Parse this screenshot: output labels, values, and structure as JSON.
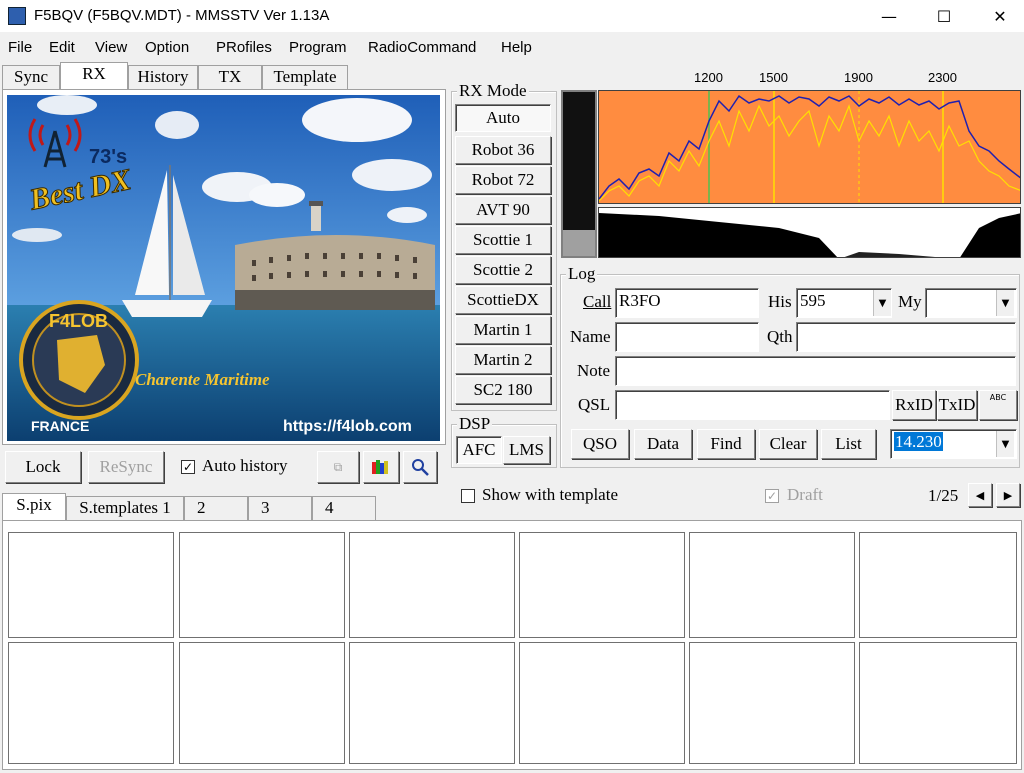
{
  "window": {
    "title": "F5BQV (F5BQV.MDT) - MMSSTV Ver 1.13A",
    "minimize": "—",
    "maximize": "☐",
    "close": "✕"
  },
  "menu": [
    "File",
    "Edit",
    "View",
    "Option",
    "PRofiles",
    "Program",
    "RadioCommand",
    "Help"
  ],
  "rx_tabs": [
    "Sync",
    "RX",
    "History",
    "TX",
    "Template"
  ],
  "image": {
    "top_text": "73's",
    "best_dx": "Best DX",
    "callsign": "F4LOB",
    "region": "Charente Maritime",
    "country": "FRANCE",
    "url": "https://f4lob.com"
  },
  "rx_buttons": {
    "lock": "Lock",
    "resync": "ReSync",
    "auto_history": "Auto history",
    "auto_history_checked": true
  },
  "rx_mode": {
    "label": "RX Mode",
    "modes": [
      "Auto",
      "Robot 36",
      "Robot 72",
      "AVT 90",
      "Scottie 1",
      "Scottie 2",
      "ScottieDX",
      "Martin 1",
      "Martin 2",
      "SC2 180"
    ],
    "selected": "Auto"
  },
  "dsp": {
    "label": "DSP",
    "afc": "AFC",
    "lms": "LMS"
  },
  "spectrum": {
    "freq_labels": [
      "1200",
      "1500",
      "1900",
      "2300"
    ],
    "bg_color": "#ff8c40",
    "trace_color": "#2020b0",
    "peak_color": "#ffe000"
  },
  "log": {
    "label": "Log",
    "call_label": "Call",
    "call_value": "R3FO",
    "his_label": "His",
    "his_value": "595",
    "my_label": "My",
    "my_value": "",
    "name_label": "Name",
    "name_value": "",
    "qth_label": "Qth",
    "qth_value": "",
    "note_label": "Note",
    "note_value": "",
    "qsl_label": "QSL",
    "qsl_value": "",
    "rxid": "RxID",
    "txid": "TxID",
    "abc_icon": "ABC",
    "buttons": [
      "QSO",
      "Data",
      "Find",
      "Clear",
      "List"
    ],
    "freq": "14.230"
  },
  "template_bar": {
    "show_with_template": "Show with template",
    "draft": "Draft",
    "page": "1/25",
    "prev": "◀",
    "next": "▶"
  },
  "bottom_tabs": [
    "S.pix",
    "S.templates 1",
    "2",
    "3",
    "4"
  ]
}
